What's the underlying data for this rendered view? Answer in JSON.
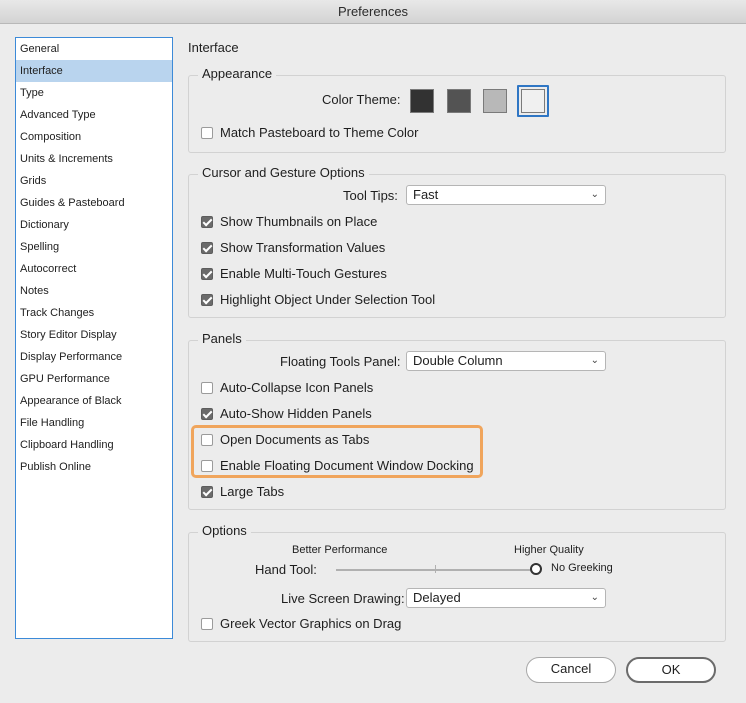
{
  "window": {
    "title": "Preferences"
  },
  "sidebar": {
    "items": [
      "General",
      "Interface",
      "Type",
      "Advanced Type",
      "Composition",
      "Units & Increments",
      "Grids",
      "Guides & Pasteboard",
      "Dictionary",
      "Spelling",
      "Autocorrect",
      "Notes",
      "Track Changes",
      "Story Editor Display",
      "Display Performance",
      "GPU Performance",
      "Appearance of Black",
      "File Handling",
      "Clipboard Handling",
      "Publish Online"
    ],
    "selected": "Interface"
  },
  "section_heading": "Interface",
  "appearance": {
    "title": "Appearance",
    "color_theme_label": "Color Theme:",
    "themes": [
      {
        "name": "dark",
        "color": "#323232"
      },
      {
        "name": "medium-dark",
        "color": "#535353"
      },
      {
        "name": "medium-light",
        "color": "#b8b8b8"
      },
      {
        "name": "light",
        "color": "#f0f0f0"
      }
    ],
    "selected_theme": "light",
    "match_pasteboard": {
      "label": "Match Pasteboard to Theme Color",
      "checked": false
    }
  },
  "cursor": {
    "title": "Cursor and Gesture Options",
    "tooltips_label": "Tool Tips:",
    "tooltips_value": "Fast",
    "options": [
      {
        "label": "Show Thumbnails on Place",
        "checked": true
      },
      {
        "label": "Show Transformation Values",
        "checked": true
      },
      {
        "label": "Enable Multi-Touch Gestures",
        "checked": true
      },
      {
        "label": "Highlight Object Under Selection Tool",
        "checked": true
      }
    ]
  },
  "panels": {
    "title": "Panels",
    "floating_label": "Floating Tools Panel:",
    "floating_value": "Double Column",
    "options": [
      {
        "label": "Auto-Collapse Icon Panels",
        "checked": false
      },
      {
        "label": "Auto-Show Hidden Panels",
        "checked": true
      },
      {
        "label": "Open Documents as Tabs",
        "checked": false
      },
      {
        "label": "Enable Floating Document Window Docking",
        "checked": false
      },
      {
        "label": "Large Tabs",
        "checked": true
      }
    ]
  },
  "options": {
    "title": "Options",
    "better_label": "Better Performance",
    "higher_label": "Higher Quality",
    "hand_tool_label": "Hand Tool:",
    "hand_tool_value": "No Greeking",
    "live_label": "Live Screen Drawing:",
    "live_value": "Delayed",
    "greek_vector": {
      "label": "Greek Vector Graphics on Drag",
      "checked": false
    }
  },
  "buttons": {
    "cancel": "Cancel",
    "ok": "OK"
  },
  "accent_color": "#2f76c4",
  "highlight_color": "#f0a55c"
}
